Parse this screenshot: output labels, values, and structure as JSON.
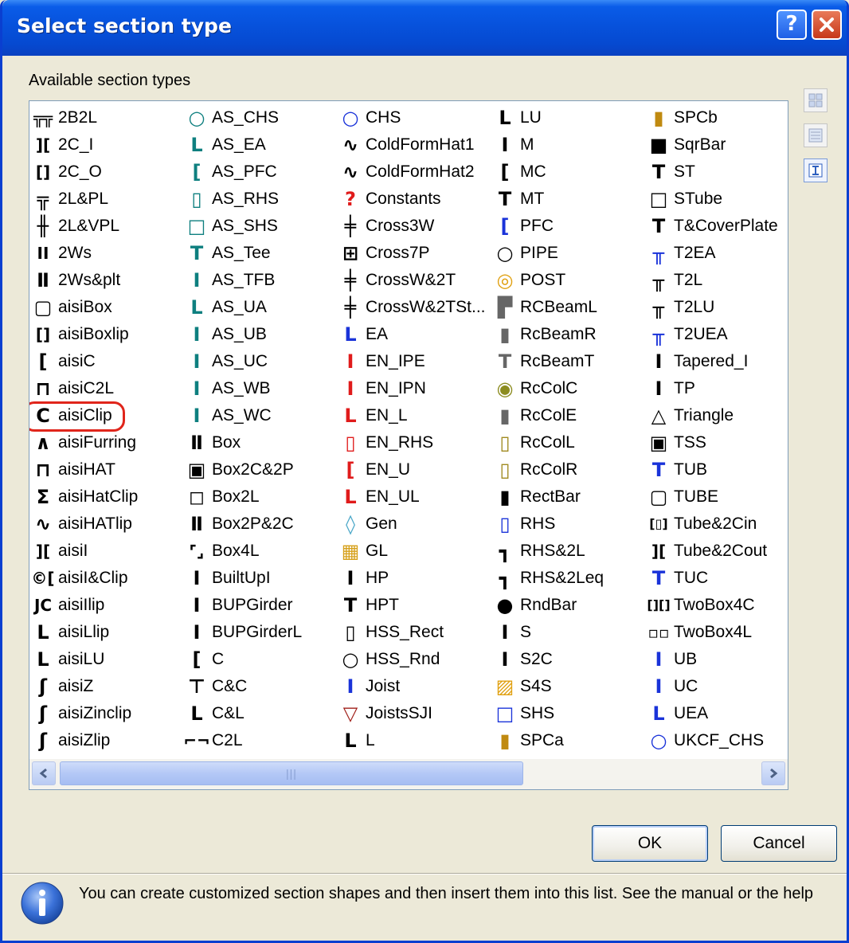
{
  "dialog": {
    "title": "Select section type",
    "help_button": "?",
    "close_button": "X"
  },
  "panel": {
    "label": "Available section types"
  },
  "columns": [
    [
      {
        "label": "2B2L",
        "icon": "2b2l-icon",
        "glyph": "╦╦",
        "color": "#000000"
      },
      {
        "label": "2C_I",
        "icon": "2c-i-icon",
        "glyph": "][",
        "color": "#000000"
      },
      {
        "label": "2C_O",
        "icon": "2c-o-icon",
        "glyph": "[]",
        "color": "#000000"
      },
      {
        "label": "2L&PL",
        "icon": "2l-pl-icon",
        "glyph": "╦",
        "color": "#000000"
      },
      {
        "label": "2L&VPL",
        "icon": "2l-vpl-icon",
        "glyph": "╫",
        "color": "#000000"
      },
      {
        "label": "2Ws",
        "icon": "2ws-icon",
        "glyph": "II",
        "color": "#000000"
      },
      {
        "label": "2Ws&plt",
        "icon": "2ws-plt-icon",
        "glyph": "Ⅱ",
        "color": "#000000"
      },
      {
        "label": "aisiBox",
        "icon": "aisibox-icon",
        "glyph": "▢",
        "color": "#000000"
      },
      {
        "label": "aisiBoxlip",
        "icon": "aisiboxlip-icon",
        "glyph": "[]",
        "color": "#000000"
      },
      {
        "label": "aisiC",
        "icon": "aisic-icon",
        "glyph": "[",
        "color": "#000000"
      },
      {
        "label": "aisiC2L",
        "icon": "aisic2l-icon",
        "glyph": "⊓",
        "color": "#000000"
      },
      {
        "label": "aisiClip",
        "icon": "aisiclip-icon",
        "glyph": "C",
        "color": "#000000"
      },
      {
        "label": "aisiFurring",
        "icon": "aisifurring-icon",
        "glyph": "∧",
        "color": "#000000"
      },
      {
        "label": "aisiHAT",
        "icon": "aisihat-icon",
        "glyph": "⊓",
        "color": "#000000"
      },
      {
        "label": "aisiHatClip",
        "icon": "aisihatclip-icon",
        "glyph": "Σ",
        "color": "#000000"
      },
      {
        "label": "aisiHATlip",
        "icon": "aisihatlip-icon",
        "glyph": "∿",
        "color": "#000000"
      },
      {
        "label": "aisiI",
        "icon": "aisii-icon",
        "glyph": "][",
        "color": "#000000"
      },
      {
        "label": "aisiI&Clip",
        "icon": "aisii-clip-icon",
        "glyph": "©[",
        "color": "#000000"
      },
      {
        "label": "aisiIlip",
        "icon": "aisiilip-icon",
        "glyph": "JC",
        "color": "#000000"
      },
      {
        "label": "aisiLlip",
        "icon": "aisillip-icon",
        "glyph": "L",
        "color": "#000000"
      },
      {
        "label": "aisiLU",
        "icon": "aisilu-icon",
        "glyph": "L",
        "color": "#000000"
      },
      {
        "label": "aisiZ",
        "icon": "aisiz-icon",
        "glyph": "ʃ",
        "color": "#000000"
      },
      {
        "label": "aisiZinclip",
        "icon": "aisizinclip-icon",
        "glyph": "ʃ",
        "color": "#000000"
      },
      {
        "label": "aisiZlip",
        "icon": "aisizlip-icon",
        "glyph": "ʃ",
        "color": "#000000"
      }
    ],
    [
      {
        "label": "AS_CHS",
        "icon": "as-chs-icon",
        "glyph": "○",
        "color": "#0e7f7f"
      },
      {
        "label": "AS_EA",
        "icon": "as-ea-icon",
        "glyph": "L",
        "color": "#0e7f7f"
      },
      {
        "label": "AS_PFC",
        "icon": "as-pfc-icon",
        "glyph": "[",
        "color": "#0e7f7f"
      },
      {
        "label": "AS_RHS",
        "icon": "as-rhs-icon",
        "glyph": "▯",
        "color": "#0e7f7f"
      },
      {
        "label": "AS_SHS",
        "icon": "as-shs-icon",
        "glyph": "□",
        "color": "#0e7f7f"
      },
      {
        "label": "AS_Tee",
        "icon": "as-tee-icon",
        "glyph": "T",
        "color": "#0e7f7f"
      },
      {
        "label": "AS_TFB",
        "icon": "as-tfb-icon",
        "glyph": "I",
        "color": "#0e7f7f"
      },
      {
        "label": "AS_UA",
        "icon": "as-ua-icon",
        "glyph": "L",
        "color": "#0e7f7f"
      },
      {
        "label": "AS_UB",
        "icon": "as-ub-icon",
        "glyph": "I",
        "color": "#0e7f7f"
      },
      {
        "label": "AS_UC",
        "icon": "as-uc-icon",
        "glyph": "I",
        "color": "#0e7f7f"
      },
      {
        "label": "AS_WB",
        "icon": "as-wb-icon",
        "glyph": "I",
        "color": "#0e7f7f"
      },
      {
        "label": "AS_WC",
        "icon": "as-wc-icon",
        "glyph": "I",
        "color": "#0e7f7f"
      },
      {
        "label": "Box",
        "icon": "box-icon",
        "glyph": "Ⅱ",
        "color": "#000000"
      },
      {
        "label": "Box2C&2P",
        "icon": "box2c-2p-icon",
        "glyph": "▣",
        "color": "#000000"
      },
      {
        "label": "Box2L",
        "icon": "box2l-icon",
        "glyph": "◻",
        "color": "#000000"
      },
      {
        "label": "Box2P&2C",
        "icon": "box2p-2c-icon",
        "glyph": "Ⅱ",
        "color": "#000000"
      },
      {
        "label": "Box4L",
        "icon": "box4l-icon",
        "glyph": "⌜⌟",
        "color": "#000000"
      },
      {
        "label": "BuiltUpI",
        "icon": "builtupi-icon",
        "glyph": "I",
        "color": "#000000"
      },
      {
        "label": "BUPGirder",
        "icon": "bupgirder-icon",
        "glyph": "Ⅰ",
        "color": "#000000"
      },
      {
        "label": "BUPGirderL",
        "icon": "bupgirderl-icon",
        "glyph": "Ⅰ",
        "color": "#000000"
      },
      {
        "label": "C",
        "icon": "c-icon",
        "glyph": "[",
        "color": "#000000"
      },
      {
        "label": "C&C",
        "icon": "c-c-icon",
        "glyph": "⊤",
        "color": "#000000"
      },
      {
        "label": "C&L",
        "icon": "c-l-icon",
        "glyph": "L",
        "color": "#000000"
      },
      {
        "label": "C2L",
        "icon": "c2l-icon",
        "glyph": "⌐¬",
        "color": "#000000"
      }
    ],
    [
      {
        "label": "CHS",
        "icon": "chs-icon",
        "glyph": "○",
        "color": "#1a33d9"
      },
      {
        "label": "ColdFormHat1",
        "icon": "coldformhat1-icon",
        "glyph": "∿",
        "color": "#000000"
      },
      {
        "label": "ColdFormHat2",
        "icon": "coldformhat2-icon",
        "glyph": "∿",
        "color": "#000000"
      },
      {
        "label": "Constants",
        "icon": "constants-icon",
        "glyph": "?",
        "color": "#e01b1b"
      },
      {
        "label": "Cross3W",
        "icon": "cross3w-icon",
        "glyph": "╪",
        "color": "#000000"
      },
      {
        "label": "Cross7P",
        "icon": "cross7p-icon",
        "glyph": "⊞",
        "color": "#000000"
      },
      {
        "label": "CrossW&2T",
        "icon": "crossw-2t-icon",
        "glyph": "╪",
        "color": "#000000"
      },
      {
        "label": "CrossW&2TSt...",
        "icon": "crossw-2tst-icon",
        "glyph": "╪",
        "color": "#000000"
      },
      {
        "label": "EA",
        "icon": "ea-icon",
        "glyph": "L",
        "color": "#1a33d9"
      },
      {
        "label": "EN_IPE",
        "icon": "en-ipe-icon",
        "glyph": "I",
        "color": "#e01b1b"
      },
      {
        "label": "EN_IPN",
        "icon": "en-ipn-icon",
        "glyph": "I",
        "color": "#e01b1b"
      },
      {
        "label": "EN_L",
        "icon": "en-l-icon",
        "glyph": "L",
        "color": "#e01b1b"
      },
      {
        "label": "EN_RHS",
        "icon": "en-rhs-icon",
        "glyph": "▯",
        "color": "#e01b1b"
      },
      {
        "label": "EN_U",
        "icon": "en-u-icon",
        "glyph": "[",
        "color": "#e01b1b"
      },
      {
        "label": "EN_UL",
        "icon": "en-ul-icon",
        "glyph": "L",
        "color": "#e01b1b"
      },
      {
        "label": "Gen",
        "icon": "gen-icon",
        "glyph": "◊",
        "color": "#4aa7c8"
      },
      {
        "label": "GL",
        "icon": "gl-icon",
        "glyph": "▦",
        "color": "#d6a01a"
      },
      {
        "label": "HP",
        "icon": "hp-icon",
        "glyph": "I",
        "color": "#000000"
      },
      {
        "label": "HPT",
        "icon": "hpt-icon",
        "glyph": "T",
        "color": "#000000"
      },
      {
        "label": "HSS_Rect",
        "icon": "hss-rect-icon",
        "glyph": "▯",
        "color": "#000000"
      },
      {
        "label": "HSS_Rnd",
        "icon": "hss-rnd-icon",
        "glyph": "○",
        "color": "#000000"
      },
      {
        "label": "Joist",
        "icon": "joist-icon",
        "glyph": "I",
        "color": "#1a33d9"
      },
      {
        "label": "JoistsSJI",
        "icon": "joistssji-icon",
        "glyph": "▽",
        "color": "#a0201a"
      },
      {
        "label": "L",
        "icon": "l-icon",
        "glyph": "L",
        "color": "#000000"
      }
    ],
    [
      {
        "label": "LU",
        "icon": "lu-icon",
        "glyph": "L",
        "color": "#000000"
      },
      {
        "label": "M",
        "icon": "m-icon",
        "glyph": "I",
        "color": "#000000"
      },
      {
        "label": "MC",
        "icon": "mc-icon",
        "glyph": "[",
        "color": "#000000"
      },
      {
        "label": "MT",
        "icon": "mt-icon",
        "glyph": "T",
        "color": "#000000"
      },
      {
        "label": "PFC",
        "icon": "pfc-icon",
        "glyph": "[",
        "color": "#1a33d9"
      },
      {
        "label": "PIPE",
        "icon": "pipe-icon",
        "glyph": "○",
        "color": "#000000"
      },
      {
        "label": "POST",
        "icon": "post-icon",
        "glyph": "◎",
        "color": "#e0a010"
      },
      {
        "label": "RCBeamL",
        "icon": "rcbeaml-icon",
        "glyph": "▛",
        "color": "#666666"
      },
      {
        "label": "RcBeamR",
        "icon": "rcbeamr-icon",
        "glyph": "▮",
        "color": "#666666"
      },
      {
        "label": "RcBeamT",
        "icon": "rcbeamt-icon",
        "glyph": "T",
        "color": "#666666"
      },
      {
        "label": "RcColC",
        "icon": "rccolc-icon",
        "glyph": "◉",
        "color": "#8c8c20"
      },
      {
        "label": "RcColE",
        "icon": "rccole-icon",
        "glyph": "▮",
        "color": "#666666"
      },
      {
        "label": "RcColL",
        "icon": "rccoll-icon",
        "glyph": "▯",
        "color": "#a08a20"
      },
      {
        "label": "RcColR",
        "icon": "rccolr-icon",
        "glyph": "▯",
        "color": "#a08a20"
      },
      {
        "label": "RectBar",
        "icon": "rectbar-icon",
        "glyph": "▮",
        "color": "#000000"
      },
      {
        "label": "RHS",
        "icon": "rhs-icon",
        "glyph": "▯",
        "color": "#1a33d9"
      },
      {
        "label": "RHS&2L",
        "icon": "rhs-2l-icon",
        "glyph": "┓",
        "color": "#000000"
      },
      {
        "label": "RHS&2Leq",
        "icon": "rhs-2leq-icon",
        "glyph": "┓",
        "color": "#000000"
      },
      {
        "label": "RndBar",
        "icon": "rndbar-icon",
        "glyph": "●",
        "color": "#000000"
      },
      {
        "label": "S",
        "icon": "s-icon",
        "glyph": "I",
        "color": "#000000"
      },
      {
        "label": "S2C",
        "icon": "s2c-icon",
        "glyph": "Ⅰ",
        "color": "#000000"
      },
      {
        "label": "S4S",
        "icon": "s4s-icon",
        "glyph": "▨",
        "color": "#e0a010"
      },
      {
        "label": "SHS",
        "icon": "shs-icon",
        "glyph": "□",
        "color": "#1a33d9"
      },
      {
        "label": "SPCa",
        "icon": "spca-icon",
        "glyph": "▮",
        "color": "#c08a10"
      }
    ],
    [
      {
        "label": "SPCb",
        "icon": "spcb-icon",
        "glyph": "▮",
        "color": "#c08a10"
      },
      {
        "label": "SqrBar",
        "icon": "sqrbar-icon",
        "glyph": "■",
        "color": "#000000"
      },
      {
        "label": "ST",
        "icon": "st-icon",
        "glyph": "T",
        "color": "#000000"
      },
      {
        "label": "STube",
        "icon": "stube-icon",
        "glyph": "□",
        "color": "#000000"
      },
      {
        "label": "T&CoverPlate",
        "icon": "t-coverplate-icon",
        "glyph": "T",
        "color": "#000000"
      },
      {
        "label": "T2EA",
        "icon": "t2ea-icon",
        "glyph": "╥",
        "color": "#1a33d9"
      },
      {
        "label": "T2L",
        "icon": "t2l-icon",
        "glyph": "╥",
        "color": "#000000"
      },
      {
        "label": "T2LU",
        "icon": "t2lu-icon",
        "glyph": "╥",
        "color": "#000000"
      },
      {
        "label": "T2UEA",
        "icon": "t2uea-icon",
        "glyph": "╥",
        "color": "#1a33d9"
      },
      {
        "label": "Tapered_I",
        "icon": "tapered-i-icon",
        "glyph": "Ⅰ",
        "color": "#000000"
      },
      {
        "label": "TP",
        "icon": "tp-icon",
        "glyph": "Ⅰ",
        "color": "#000000"
      },
      {
        "label": "Triangle",
        "icon": "triangle-icon",
        "glyph": "△",
        "color": "#000000"
      },
      {
        "label": "TSS",
        "icon": "tss-icon",
        "glyph": "▣",
        "color": "#000000"
      },
      {
        "label": "TUB",
        "icon": "tub-icon",
        "glyph": "T",
        "color": "#1a33d9"
      },
      {
        "label": "TUBE",
        "icon": "tube-icon",
        "glyph": "▢",
        "color": "#000000"
      },
      {
        "label": "Tube&2Cin",
        "icon": "tube-2cin-icon",
        "glyph": "[▯]",
        "color": "#000000"
      },
      {
        "label": "Tube&2Cout",
        "icon": "tube-2cout-icon",
        "glyph": "][",
        "color": "#000000"
      },
      {
        "label": "TUC",
        "icon": "tuc-icon",
        "glyph": "T",
        "color": "#1a33d9"
      },
      {
        "label": "TwoBox4C",
        "icon": "twobox4c-icon",
        "glyph": "[][]",
        "color": "#000000"
      },
      {
        "label": "TwoBox4L",
        "icon": "twobox4l-icon",
        "glyph": "▫▫",
        "color": "#000000"
      },
      {
        "label": "UB",
        "icon": "ub-icon",
        "glyph": "I",
        "color": "#1a33d9"
      },
      {
        "label": "UC",
        "icon": "uc-icon",
        "glyph": "I",
        "color": "#1a33d9"
      },
      {
        "label": "UEA",
        "icon": "uea-icon",
        "glyph": "L",
        "color": "#1a33d9"
      },
      {
        "label": "UKCF_CHS",
        "icon": "ukcf-chs-icon",
        "glyph": "○",
        "color": "#1a33d9"
      }
    ]
  ],
  "scrollbar": {
    "left_arrow": "<",
    "right_arrow": ">",
    "grip": "|||",
    "position": 0.0
  },
  "side_toolbar": [
    {
      "name": "large-icons-view-icon"
    },
    {
      "name": "list-view-icon"
    },
    {
      "name": "section-shape-view-icon"
    }
  ],
  "buttons": {
    "ok": "OK",
    "cancel": "Cancel"
  },
  "info": {
    "text": "You can create customized section shapes and then insert them into this list. See the manual or the help"
  },
  "selected_item": "aisiClip",
  "colors": {
    "title_blue": "#0752dc",
    "highlight_red": "#e0251b",
    "teal": "#0e7f7f",
    "blue": "#1a33d9",
    "red": "#e01b1b"
  }
}
